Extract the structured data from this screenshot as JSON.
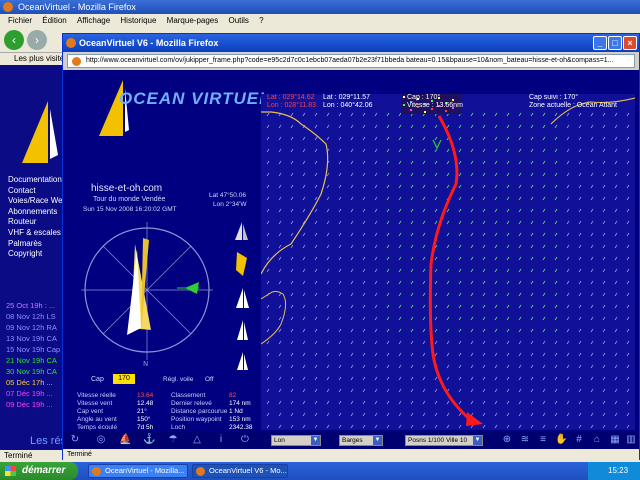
{
  "background_window": {
    "title": "OceanVirtuel - Mozilla Firefox",
    "menu": [
      "Fichier",
      "Édition",
      "Affichage",
      "Historique",
      "Marque-pages",
      "Outils",
      "?"
    ],
    "bookmark": "Les plus visités",
    "side_menu": [
      "Documentation",
      "Contact",
      "Voies/Race Week",
      "Abonnements",
      "Routeur",
      "VHF & escales",
      "Palmarès",
      "Copyright"
    ],
    "race_list": [
      {
        "text": "25 Oct 19h : ...",
        "color": "#c878ff"
      },
      {
        "text": "08 Nov 12h LS",
        "color": "#9090ff"
      },
      {
        "text": "09 Nov 12h RA",
        "color": "#9090ff"
      },
      {
        "text": "13 Nov 19h CA",
        "color": "#9090ff"
      },
      {
        "text": "15 Nov 19h Cap",
        "color": "#9090ff"
      },
      {
        "text": "21 Nov 19h CA",
        "color": "#30e030"
      },
      {
        "text": "30 Nov 19h CA",
        "color": "#30e030"
      },
      {
        "text": "05 Déc 17h ...",
        "color": "#ffd020"
      },
      {
        "text": "07 Déc 19h ...",
        "color": "#ff40ff"
      },
      {
        "text": "09 Déc 19h ...",
        "color": "#ff40ff"
      }
    ],
    "footer": "Les rés",
    "status": "Terminé"
  },
  "popup": {
    "title": "OceanVirtuel V6 - Mozilla Firefox",
    "url": "http://www.oceanvirtuel.com/ov/jukipper_frame.php?code=e95c2d7c0c1ebcb07aeda07b2e23f71bbeda bateau=0.15&bpause=10&nom_bateau=hisse-et-oh&compass=1...",
    "status": "Terminé",
    "logo": "OCEAN VIRTUEL",
    "boat_name": "hisse-et-oh.com",
    "race_name": "Tour du monde Vendée",
    "date_line": "Sun 15 Nov 2008 16:20:02 GMT",
    "wind_label_1": "Lat 47°50.06",
    "wind_label_2": "Lon 2°34'W",
    "cap_label": "Cap",
    "cap_value": "170",
    "reglage_label": "Régl. voile",
    "reglage_value": "Off",
    "stats_left_labels": [
      "Vitesse réelle",
      "Vitesse vent",
      "Cap vent",
      "Angle au vent",
      "Temps écoulé"
    ],
    "stats_left_values": [
      "13.64",
      "12.48",
      "21°",
      "150°",
      "7d 5h"
    ],
    "stats_right_labels": [
      "Classement",
      "Dernier relevé",
      "Distance parcourue",
      "Position waypoint",
      "Loch"
    ],
    "stats_right_values": [
      "82",
      "174 nm",
      "1 Nd",
      "153 nm",
      "2342.38"
    ],
    "top_info": [
      {
        "text": "Lat : 029°14.62",
        "color": "#ff4040"
      },
      {
        "text": "Lon : 028°11.83",
        "color": "#ff4040"
      },
      {
        "text": "Lat : 029°11.57",
        "color": "#ffffff"
      },
      {
        "text": "Lon : 040°42.06",
        "color": "#ffffff"
      },
      {
        "text": "Cap : 170°",
        "color": "#ffffff"
      },
      {
        "text": "Vitesse : 13.66nm",
        "color": "#ffffff"
      },
      {
        "text": "Cap suivi : 170°",
        "color": "#ffffff"
      },
      {
        "text": "Zone actuelle : Océan Atlant",
        "color": "#ffffff"
      }
    ],
    "toolbar_selects": [
      "Lon",
      "Barges",
      "Posns 1/100 Ville 10"
    ]
  },
  "taskbar": {
    "start_label": "démarrer",
    "tasks": [
      "OceanVirtuel - Mozilla...",
      "OceanVirtuel V6 - Mo..."
    ],
    "clock": "15:23"
  },
  "colors": {
    "page_bg": "#000080",
    "map_bg": "#101098",
    "route_color": "#ff1a1a",
    "coast_color": "#e8c050"
  }
}
